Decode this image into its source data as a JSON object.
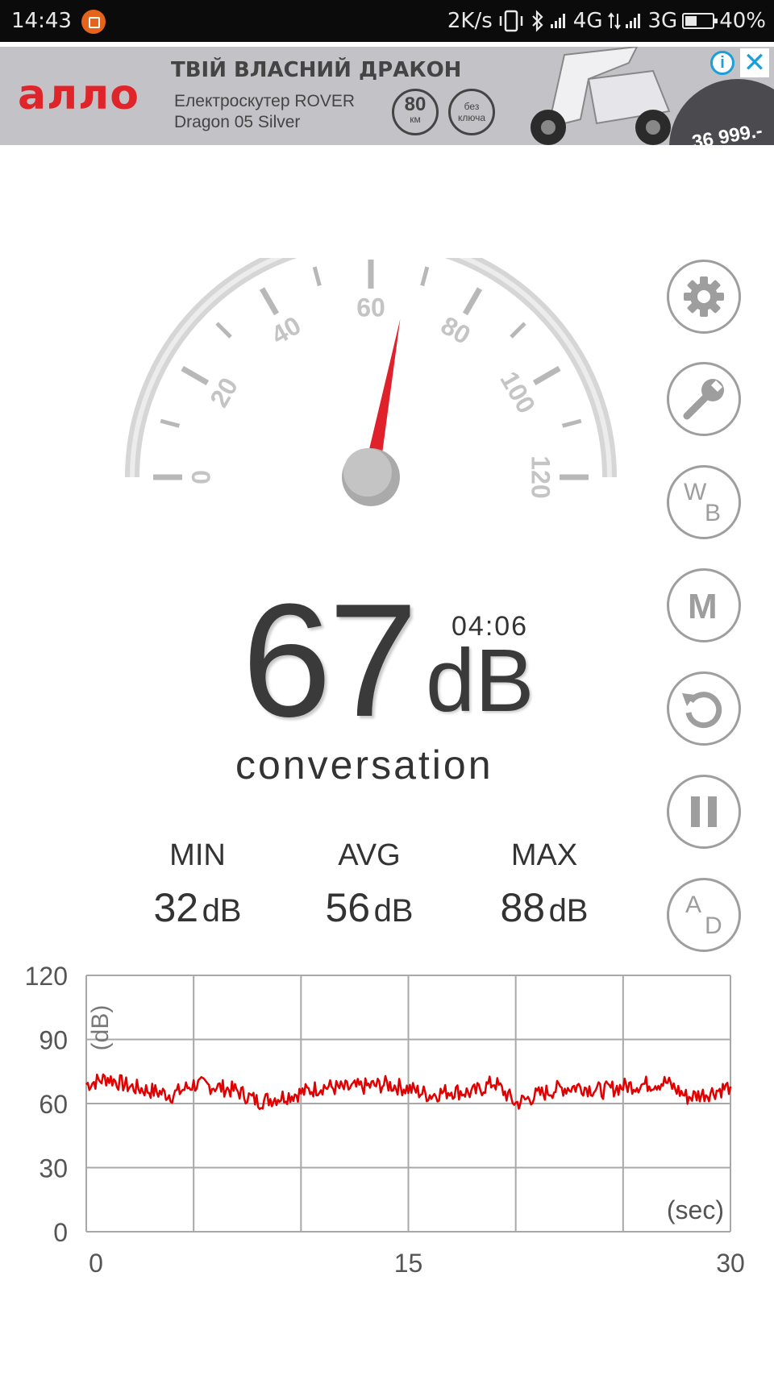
{
  "status_bar": {
    "time": "14:43",
    "net_speed": "2K/s",
    "net1": "4G",
    "net2": "3G",
    "battery": "40%"
  },
  "ad": {
    "brand": "алло",
    "headline": "ТВІЙ ВЛАСНИЙ ДРАКОН",
    "line1": "Електроскутер ROVER",
    "line2": "Dragon 05 Silver",
    "badge1_big": "80",
    "badge1_small": "км",
    "badge2_small": "без ключа",
    "price": "36 999.-",
    "info_icon": "info-icon",
    "close_icon": "close-icon",
    "colors": {
      "brand": "#e0252a",
      "ad_choice": "#1a9fd9"
    }
  },
  "gauge": {
    "min": 0,
    "max": 120,
    "tick_labels": [
      "0",
      "20",
      "40",
      "60",
      "80",
      "100",
      "120"
    ],
    "needle_value": 67,
    "colors": {
      "needle": "#e0202a",
      "ring": "#d8d8d8",
      "ticks": "#b8b8b8"
    }
  },
  "reading": {
    "value": "67",
    "unit": "dB",
    "elapsed": "04:06",
    "description": "conversation"
  },
  "stats": {
    "min": {
      "label": "MIN",
      "value": "32",
      "unit": "dB"
    },
    "avg": {
      "label": "AVG",
      "value": "56",
      "unit": "dB"
    },
    "max": {
      "label": "MAX",
      "value": "88",
      "unit": "dB"
    }
  },
  "side_buttons": {
    "settings": {
      "icon": "gear-icon"
    },
    "tools": {
      "icon": "wrench-icon"
    },
    "weighting": {
      "top": "W",
      "bottom": "B"
    },
    "mode": {
      "label": "M"
    },
    "reset": {
      "icon": "reset-icon"
    },
    "pause": {
      "icon": "pause-icon"
    },
    "ad_mode": {
      "top": "A",
      "bottom": "D"
    }
  },
  "chart_data": {
    "type": "line",
    "ylabel": "(dB)",
    "xlabel": "(sec)",
    "ylim": [
      0,
      120
    ],
    "xlim": [
      0,
      30
    ],
    "y_ticks": [
      "120",
      "90",
      "60",
      "30",
      "0"
    ],
    "x_ticks": [
      "0",
      "15",
      "30"
    ],
    "grid": true,
    "series": [
      {
        "color": "#e00000",
        "x": [
          0,
          1,
          2,
          3,
          4,
          5,
          6,
          7,
          8,
          9,
          10,
          11,
          12,
          13,
          14,
          15,
          16,
          17,
          18,
          19,
          20,
          21,
          22,
          23,
          24,
          25,
          26,
          27,
          28,
          29,
          30
        ],
        "values": [
          69,
          72,
          68,
          66,
          64,
          69,
          68,
          66,
          61,
          63,
          65,
          68,
          67,
          68,
          69,
          67,
          64,
          66,
          65,
          70,
          60,
          64,
          67,
          68,
          66,
          68,
          69,
          70,
          63,
          65,
          68
        ]
      }
    ]
  }
}
